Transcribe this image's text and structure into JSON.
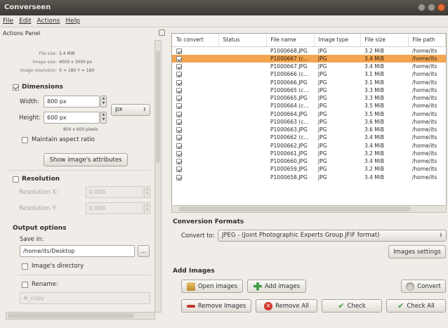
{
  "app": {
    "title": "Converseen"
  },
  "menu": [
    "File",
    "Edit",
    "Actions",
    "Help"
  ],
  "actions_panel": {
    "title": "Actions Panel",
    "info": [
      {
        "k": "File size:",
        "v": "3.4 MiB"
      },
      {
        "k": "Image size:",
        "v": "4000 x 3000 px"
      },
      {
        "k": "Image resolution:",
        "v": "X = 180 Y = 180"
      }
    ],
    "dimensions": {
      "label": "Dimensions",
      "width_label": "Width:",
      "width_value": "800 px",
      "height_label": "Height:",
      "height_value": "600 px",
      "unit": "px",
      "summary": "800 x 600 pixels",
      "aspect_label": "Maintain aspect ratio",
      "attrs_button": "Show image's attributes"
    },
    "resolution": {
      "label": "Resolution",
      "x_label": "Resolution X:",
      "x_value": "0.000",
      "y_label": "Resolution Y:",
      "y_value": "0.000"
    },
    "output": {
      "label": "Output options",
      "save_in_label": "Save in:",
      "save_path": "/home/its/Desktop",
      "browse_button": "...",
      "image_dir_label": "Image's directory",
      "rename_label": "Rename:",
      "rename_value": "#_copy"
    }
  },
  "table": {
    "columns": [
      "To convert",
      "Status",
      "File name",
      "Image type",
      "File size",
      "File path"
    ],
    "rows": [
      {
        "name": "P1000668.JPG",
        "type": "JPG",
        "size": "3.2 MiB",
        "path": "/home/its",
        "sel": false
      },
      {
        "name": "P1000667 (c...",
        "type": "JPG",
        "size": "3.4 MiB",
        "path": "/home/its",
        "sel": true
      },
      {
        "name": "P1000667.JPG",
        "type": "JPG",
        "size": "3.4 MiB",
        "path": "/home/its",
        "sel": false
      },
      {
        "name": "P1000666 (c...",
        "type": "JPG",
        "size": "3.1 MiB",
        "path": "/home/its",
        "sel": false
      },
      {
        "name": "P1000666.JPG",
        "type": "JPG",
        "size": "3.1 MiB",
        "path": "/home/its",
        "sel": false
      },
      {
        "name": "P1000665 (c...",
        "type": "JPG",
        "size": "3.3 MiB",
        "path": "/home/its",
        "sel": false
      },
      {
        "name": "P1000665.JPG",
        "type": "JPG",
        "size": "3.3 MiB",
        "path": "/home/its",
        "sel": false
      },
      {
        "name": "P1000664 (c...",
        "type": "JPG",
        "size": "3.5 MiB",
        "path": "/home/its",
        "sel": false
      },
      {
        "name": "P1000664.JPG",
        "type": "JPG",
        "size": "3.5 MiB",
        "path": "/home/its",
        "sel": false
      },
      {
        "name": "P1000663 (c...",
        "type": "JPG",
        "size": "3.6 MiB",
        "path": "/home/its",
        "sel": false
      },
      {
        "name": "P1000663.JPG",
        "type": "JPG",
        "size": "3.6 MiB",
        "path": "/home/its",
        "sel": false
      },
      {
        "name": "P1000662 (c...",
        "type": "JPG",
        "size": "3.4 MiB",
        "path": "/home/its",
        "sel": false
      },
      {
        "name": "P1000662.JPG",
        "type": "JPG",
        "size": "3.4 MiB",
        "path": "/home/its",
        "sel": false
      },
      {
        "name": "P1000661.JPG",
        "type": "JPG",
        "size": "3.2 MiB",
        "path": "/home/its",
        "sel": false
      },
      {
        "name": "P1000660.JPG",
        "type": "JPG",
        "size": "3.4 MiB",
        "path": "/home/its",
        "sel": false
      },
      {
        "name": "P1000659.JPG",
        "type": "JPG",
        "size": "3.2 MiB",
        "path": "/home/its",
        "sel": false
      },
      {
        "name": "P1000658.JPG",
        "type": "JPG",
        "size": "3.4 MiB",
        "path": "/home/its",
        "sel": false
      }
    ]
  },
  "conversion": {
    "label": "Conversion Formats",
    "convert_to_label": "Convert to:",
    "format": "JPEG - (Joint Photographic Experts Group JFIF format)",
    "settings_button": "Images settings"
  },
  "add_images": {
    "label": "Add Images",
    "open_button": "Open images",
    "add_button": "Add images",
    "convert_button": "Convert",
    "remove_button": "Remove Images",
    "remove_all_button": "Remove All",
    "check_button": "Check",
    "check_all_button": "Check All"
  }
}
